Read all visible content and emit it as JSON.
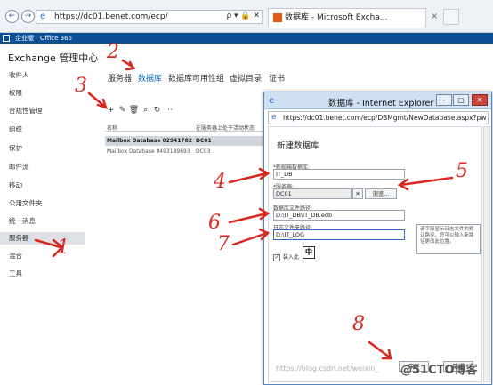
{
  "browser": {
    "back_glyph": "←",
    "forward_glyph": "→",
    "url": "https://dc01.benet.com/ecp/",
    "addr_tools": "ρ ▾ 🔒 ✕",
    "tab_title": "数据库 - Microsoft Excha...",
    "tab_close": "×"
  },
  "o365": {
    "links": [
      "企业版",
      "Office 365"
    ]
  },
  "ecp": {
    "title": "Exchange 管理中心",
    "nav": [
      "收件人",
      "权限",
      "合规性管理",
      "组织",
      "保护",
      "邮件流",
      "移动",
      "公用文件夹",
      "统一消息",
      "服务器",
      "混合",
      "工具"
    ],
    "active_nav": "服务器",
    "tabs": [
      "服务器",
      "数据库",
      "数据库可用性组",
      "虚拟目录",
      "证书"
    ],
    "active_tab": "数据库",
    "toolbar": [
      "+",
      "✎",
      "🗑",
      "⌕",
      "↻",
      "···"
    ],
    "table_headers": [
      "名称",
      "在服务器上处于活动状态"
    ],
    "rows": [
      {
        "name": "Mailbox Database 02941782...",
        "server": "DC01"
      },
      {
        "name": "Mailbox Database 0493189693",
        "server": "DC03"
      }
    ]
  },
  "popup": {
    "title": "数据库 - Internet Explorer",
    "url": "https://dc01.benet.com/ecp/DBMgmt/NewDatabase.aspx?pw",
    "form_title": "新建数据库",
    "name_label": "*新邮箱数据库:",
    "name_value": "IT_DB",
    "server_label": "*服务器:",
    "server_value": "DC01",
    "clear_glyph": "✕",
    "browse_label": "浏览...",
    "db_path_label": "数据库文件路径:",
    "db_path_value": "D:\\IT_DB\\IT_DB.edb",
    "log_path_label": "日志文件夹路径:",
    "log_path_value": "D:\\IT_LOG",
    "tooltip": "请字段显示日志文件的默认路径。您可以输入新路径更改此位置。",
    "mount_label": "装入此",
    "mount_check": "✓",
    "ime": "中",
    "save_label": "保存",
    "cancel_label": "取消"
  },
  "annotations": {
    "numbers": [
      "1",
      "2",
      "3",
      "4",
      "5",
      "6",
      "7",
      "8"
    ],
    "color": "#d8281f"
  },
  "watermark": "https://blog.csdn.net/weixin_",
  "brand": "@51CTO博客"
}
